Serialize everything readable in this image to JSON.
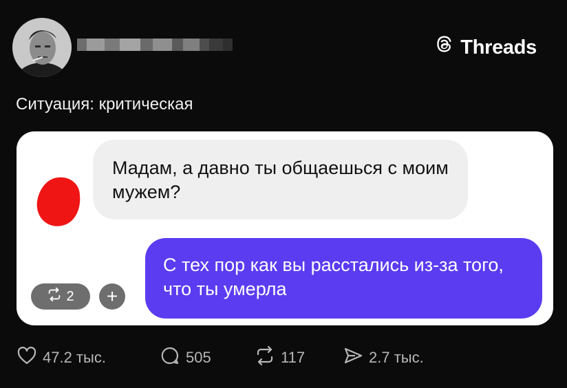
{
  "brand": {
    "name": "Threads",
    "icon": "threads-logo-icon"
  },
  "post": {
    "caption": "Ситуация: критическая",
    "username_blurred": true
  },
  "screenshot_card": {
    "incoming_message": "Мадам, а давно ты общаешься с моим мужем?",
    "outgoing_message": "С тех пор как вы расстались из-за того, что ты умерла",
    "repost_count": "2",
    "add_label": "+"
  },
  "stats": {
    "likes": "47.2 тыс.",
    "comments": "505",
    "reposts": "117",
    "shares": "2.7 тыс."
  },
  "colors": {
    "background": "#0b0b0b",
    "outgoing_bubble": "#5b3cf0",
    "incoming_bubble": "#efefef",
    "redacted_blob": "#f01515"
  }
}
